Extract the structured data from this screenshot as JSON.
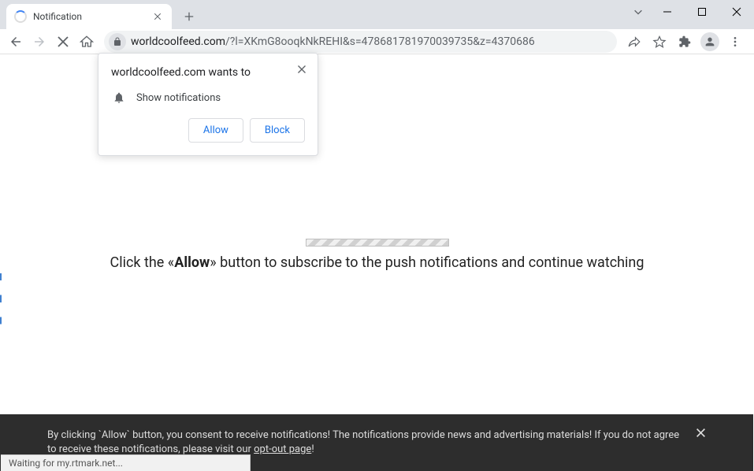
{
  "tab": {
    "title": "Notification"
  },
  "toolbar": {
    "url_domain": "worldcoolfeed.com",
    "url_path": "/?l=XKmG8ooqkNkREHI&s=478681781970039735&z=4370686"
  },
  "popup": {
    "title": "worldcoolfeed.com wants to",
    "permission": "Show notifications",
    "allow_label": "Allow",
    "block_label": "Block"
  },
  "page": {
    "msg_pre": "Click the «",
    "msg_bold": "Allow",
    "msg_post": "» button to subscribe to the push notifications and continue watching"
  },
  "consent": {
    "text_pre": "By clicking `Allow` button, you consent to receive notifications! The notifications provide news and advertising materials! If you do not agree to receive these notifications, please visit our ",
    "link": "opt-out page",
    "text_post": "!"
  },
  "status": {
    "text": "Waiting for my.rtmark.net..."
  }
}
